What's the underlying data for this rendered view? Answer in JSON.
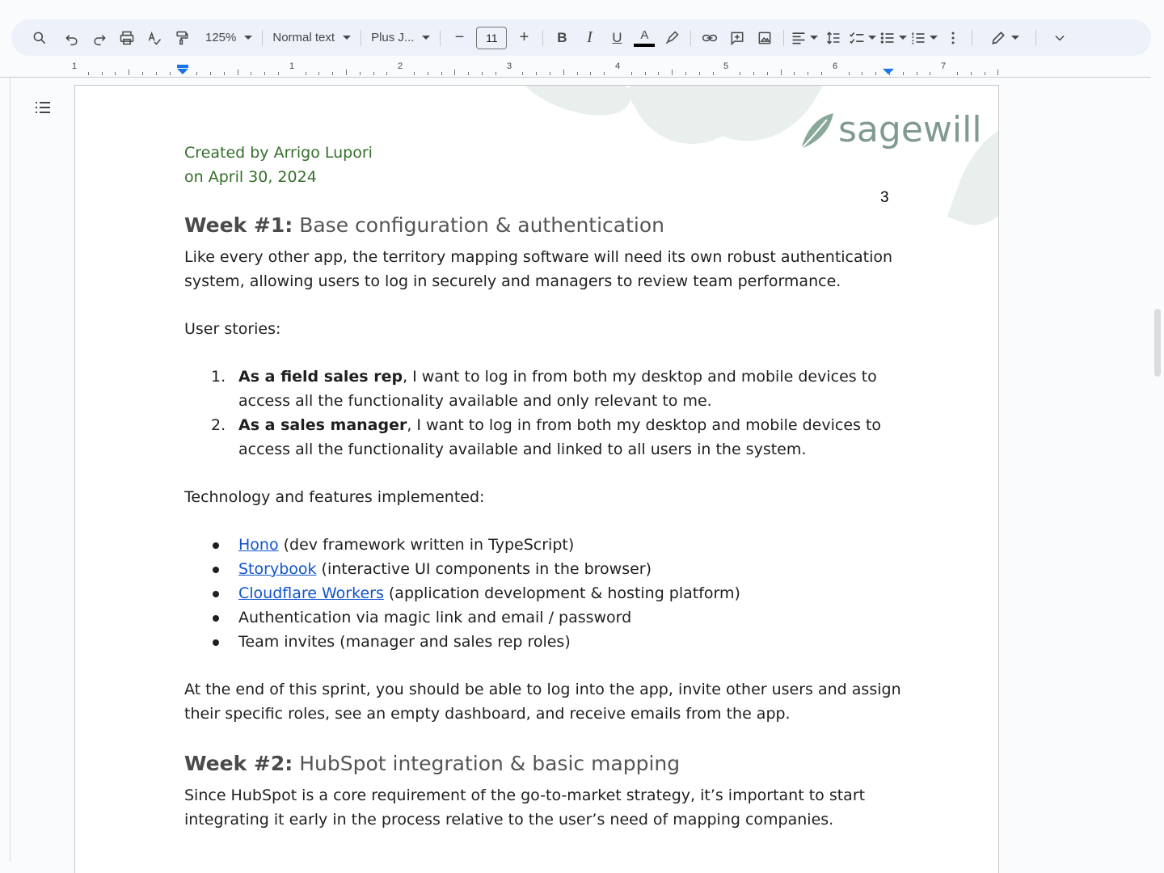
{
  "toolbar": {
    "zoom": "125%",
    "style": "Normal text",
    "font": "Plus J...",
    "font_size": "11",
    "minus": "−",
    "plus": "+",
    "bold": "B",
    "italic": "I",
    "underline": "U",
    "text_color": "A"
  },
  "ruler": {
    "numbers": [
      "1",
      "1",
      "2",
      "3",
      "4",
      "5",
      "6",
      "7"
    ]
  },
  "logo": {
    "text": "sagewill"
  },
  "page_number": "3",
  "doc": {
    "meta_line1": "Created by Arrigo Lupori",
    "meta_line2": "on April 30, 2024",
    "week1": {
      "label": "Week #1:",
      "title": " Base configuration & authentication",
      "intro": "Like every other app, the territory mapping software will need its own robust authentication system, allowing users to log in securely and managers to review team performance.",
      "stories_label": "User stories:",
      "stories": [
        {
          "num": "1.",
          "bold": "As a field sales rep",
          "rest": ", I want to log in from both my desktop and mobile devices to access all the functionality available and only relevant to me."
        },
        {
          "num": "2.",
          "bold": "As a sales manager",
          "rest": ", I want to log in from both my desktop and mobile devices to access all the functionality available and linked to all users in the system."
        }
      ],
      "tech_label": "Technology and features implemented:",
      "tech": [
        {
          "link": "Hono",
          "rest": " (dev framework written in TypeScript)"
        },
        {
          "link": "Storybook",
          "rest": " (interactive UI components in the browser)"
        },
        {
          "link": "Cloudflare Workers",
          "rest": " (application development & hosting platform)"
        },
        {
          "link": "",
          "rest": "Authentication via magic link and email / password"
        },
        {
          "link": "",
          "rest": "Team invites (manager and sales rep roles)"
        }
      ],
      "outro": "At the end of this sprint, you should be able to log into the app, invite other users and assign their specific roles, see an empty dashboard, and receive emails from the app."
    },
    "week2": {
      "label": "Week #2:",
      "title": " HubSpot integration & basic mapping",
      "intro": "Since HubSpot is a core requirement of the go-to-market strategy, it’s important to start integrating it early in the process relative to the user’s need of mapping companies."
    }
  },
  "colors": {
    "toolbar_bg": "#edf2fa",
    "meta_green": "#356f2b",
    "link_blue": "#1155cc",
    "accent_blue": "#1a73e8",
    "logo_green": "#7f9a8e"
  },
  "icons": [
    "search-icon",
    "undo-icon",
    "redo-icon",
    "print-icon",
    "spellcheck-icon",
    "paint-format-icon",
    "highlighter-icon",
    "link-icon",
    "add-comment-icon",
    "insert-image-icon",
    "align-icon",
    "line-spacing-icon",
    "checklist-icon",
    "bullet-list-icon",
    "numbered-list-icon",
    "more-icon",
    "editing-mode-icon",
    "collapse-icon",
    "outline-icon"
  ]
}
